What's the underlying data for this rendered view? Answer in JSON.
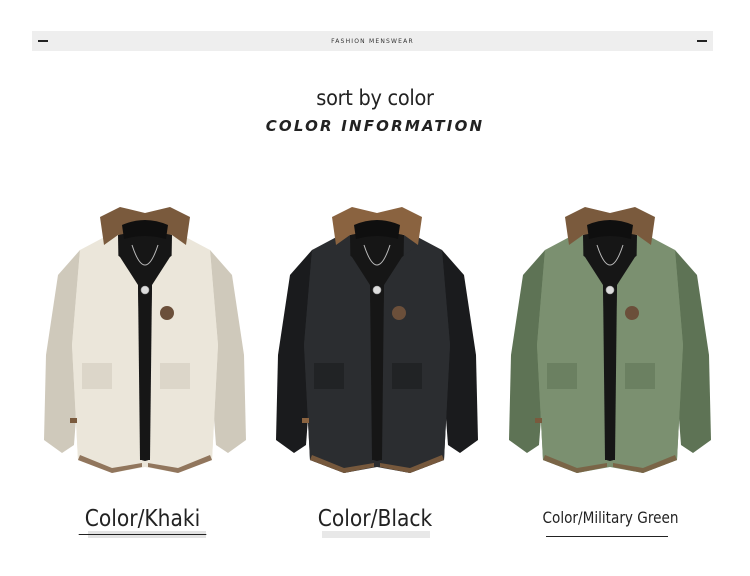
{
  "banner": {
    "brand": "FASHION MENSWEAR"
  },
  "header": {
    "title": "sort by color",
    "subtitle": "COLOR INFORMATION"
  },
  "products": [
    {
      "label": "Color/Khaki",
      "color_body": "#ebe6da",
      "color_shade": "#cfc9bb",
      "color_collar": "#7a5a3d"
    },
    {
      "label": "Color/Black",
      "color_body": "#2b2d30",
      "color_shade": "#1a1b1d",
      "color_collar": "#8a6340"
    },
    {
      "label": "Color/Military Green",
      "color_body": "#7b9070",
      "color_shade": "#5e7355",
      "color_collar": "#7a5a3d"
    }
  ],
  "colors": {
    "inner_tee": "#161616",
    "badge": "#6b4f3a",
    "text": "#222222"
  }
}
